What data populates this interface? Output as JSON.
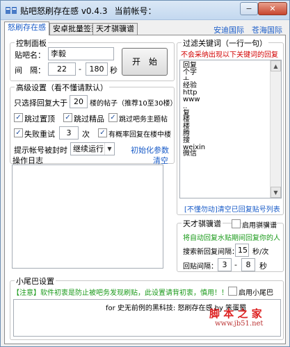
{
  "window": {
    "title": "贴吧怒刷存在感 v0.4.3",
    "account_label": "当前帐号：",
    "min_btn": "−",
    "close_btn": "✕"
  },
  "tabs": [
    {
      "label": "怒刷存在感"
    },
    {
      "label": "安卓批量签到"
    },
    {
      "label": "天才骐骥谱"
    }
  ],
  "top_links": {
    "link_a": "安迪国际",
    "link_b": "苍海国际"
  },
  "control_panel": {
    "title": "控制面板",
    "bar_label": "贴吧名：",
    "bar_value": "李毅",
    "interval_label": "间　隔：",
    "interval_from": "22",
    "interval_dash": "-",
    "interval_to": "180",
    "interval_unit": "秒",
    "start_button": "开　始"
  },
  "advanced": {
    "title": "高级设置（看不懂请默认）",
    "reply_prefix": "只选择回复大于",
    "reply_value": "20",
    "reply_suffix": "楼的帖子（推荐10至30楼）",
    "skip_top": "跳过置顶",
    "skip_fine": "跳过精品",
    "skip_owner": "跳过吧务主题帖",
    "fail_retry": "失败重试",
    "fail_value": "3",
    "fail_unit": "次",
    "prob_reply": "有概率回复在楼中楼",
    "blocked_label": "提示帐号被封时",
    "blocked_option": "继续运行",
    "init_params": "初始化参数"
  },
  "oplog": {
    "title": "操作日志",
    "clear": "清空"
  },
  "filter": {
    "title": "过滤关键词（一行一句）",
    "hint": "不会采纳出现以下关键词的回复",
    "keywords": [
      "回复",
      "个字",
      "ㅗ",
      "经验",
      "http",
      "www",
      "..",
      "复",
      "楼",
      "楼",
      "腾",
      "搜",
      "weixin",
      "微信"
    ],
    "clear_hint": "[不懂勿动]清空已回复贴号列表"
  },
  "tiancai": {
    "title": "天才骐骥谱",
    "enable": "启用骐骥谱",
    "desc": "将自动回复水贴期间回复你的人",
    "search_label": "搜索新回复间隔：",
    "search_value": "15",
    "search_unit": "秒/次",
    "reply_label": "回贴间隔：",
    "reply_from": "3",
    "reply_dash": "-",
    "reply_to": "8",
    "reply_unit": "秒"
  },
  "tail": {
    "title": "小尾巴设置",
    "notice": "【注意】软件初衷是防止被吧务发现刷贴，此设置请背初衷，慎用！！！",
    "enable": "启用小尾巴",
    "text": "for 史无前例的黑科技: 怒刷存在感 by 笨蛋蜀"
  },
  "watermark": {
    "brand": "脚 本 之 家",
    "url": "www.jb51.net"
  }
}
